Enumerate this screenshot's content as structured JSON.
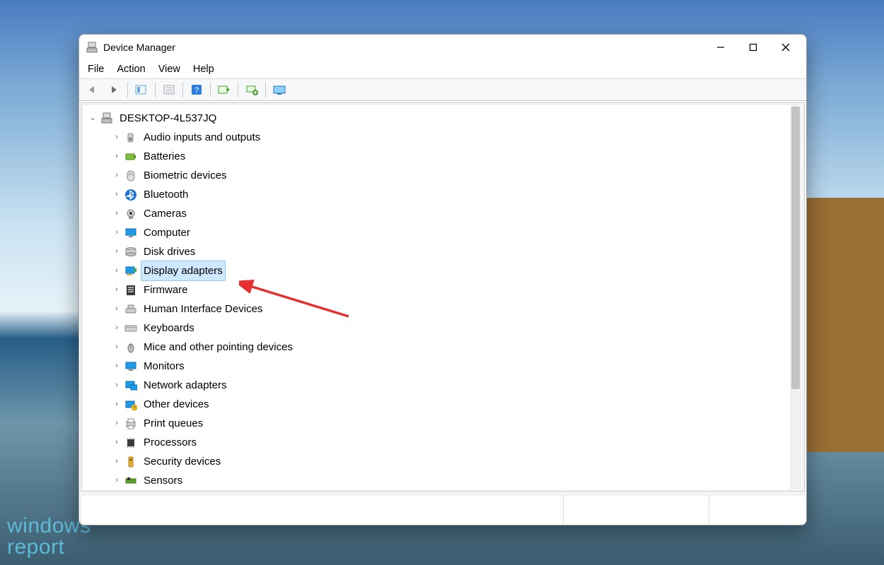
{
  "watermark": {
    "line1": "windows",
    "line2": "report"
  },
  "window": {
    "title": "Device Manager",
    "menu": [
      "File",
      "Action",
      "View",
      "Help"
    ],
    "computer_name": "DESKTOP-4L537JQ",
    "selected_index": 7,
    "categories": [
      {
        "label": "Audio inputs and outputs",
        "icon": "speaker"
      },
      {
        "label": "Batteries",
        "icon": "battery"
      },
      {
        "label": "Biometric devices",
        "icon": "fingerprint"
      },
      {
        "label": "Bluetooth",
        "icon": "bluetooth"
      },
      {
        "label": "Cameras",
        "icon": "camera"
      },
      {
        "label": "Computer",
        "icon": "monitor"
      },
      {
        "label": "Disk drives",
        "icon": "disk"
      },
      {
        "label": "Display adapters",
        "icon": "display-adapter"
      },
      {
        "label": "Firmware",
        "icon": "firmware"
      },
      {
        "label": "Human Interface Devices",
        "icon": "hid"
      },
      {
        "label": "Keyboards",
        "icon": "keyboard"
      },
      {
        "label": "Mice and other pointing devices",
        "icon": "mouse"
      },
      {
        "label": "Monitors",
        "icon": "monitor"
      },
      {
        "label": "Network adapters",
        "icon": "network"
      },
      {
        "label": "Other devices",
        "icon": "other"
      },
      {
        "label": "Print queues",
        "icon": "printer"
      },
      {
        "label": "Processors",
        "icon": "cpu"
      },
      {
        "label": "Security devices",
        "icon": "security"
      },
      {
        "label": "Sensors",
        "icon": "sensor"
      }
    ]
  }
}
